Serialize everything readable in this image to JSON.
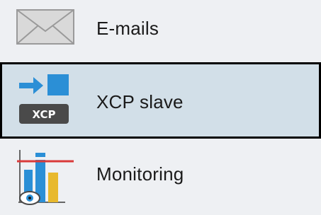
{
  "menu": {
    "items": [
      {
        "label": "E-mails",
        "icon": "envelope-icon",
        "selected": false
      },
      {
        "label": "XCP slave",
        "icon": "xcp-slave-icon",
        "badge": "XCP",
        "selected": true
      },
      {
        "label": "Monitoring",
        "icon": "monitoring-chart-icon",
        "selected": false
      }
    ]
  },
  "colors": {
    "background": "#eef0f3",
    "selected_background": "#d2dfe8",
    "selected_border": "#000000",
    "accent_blue": "#2b8fd6"
  }
}
